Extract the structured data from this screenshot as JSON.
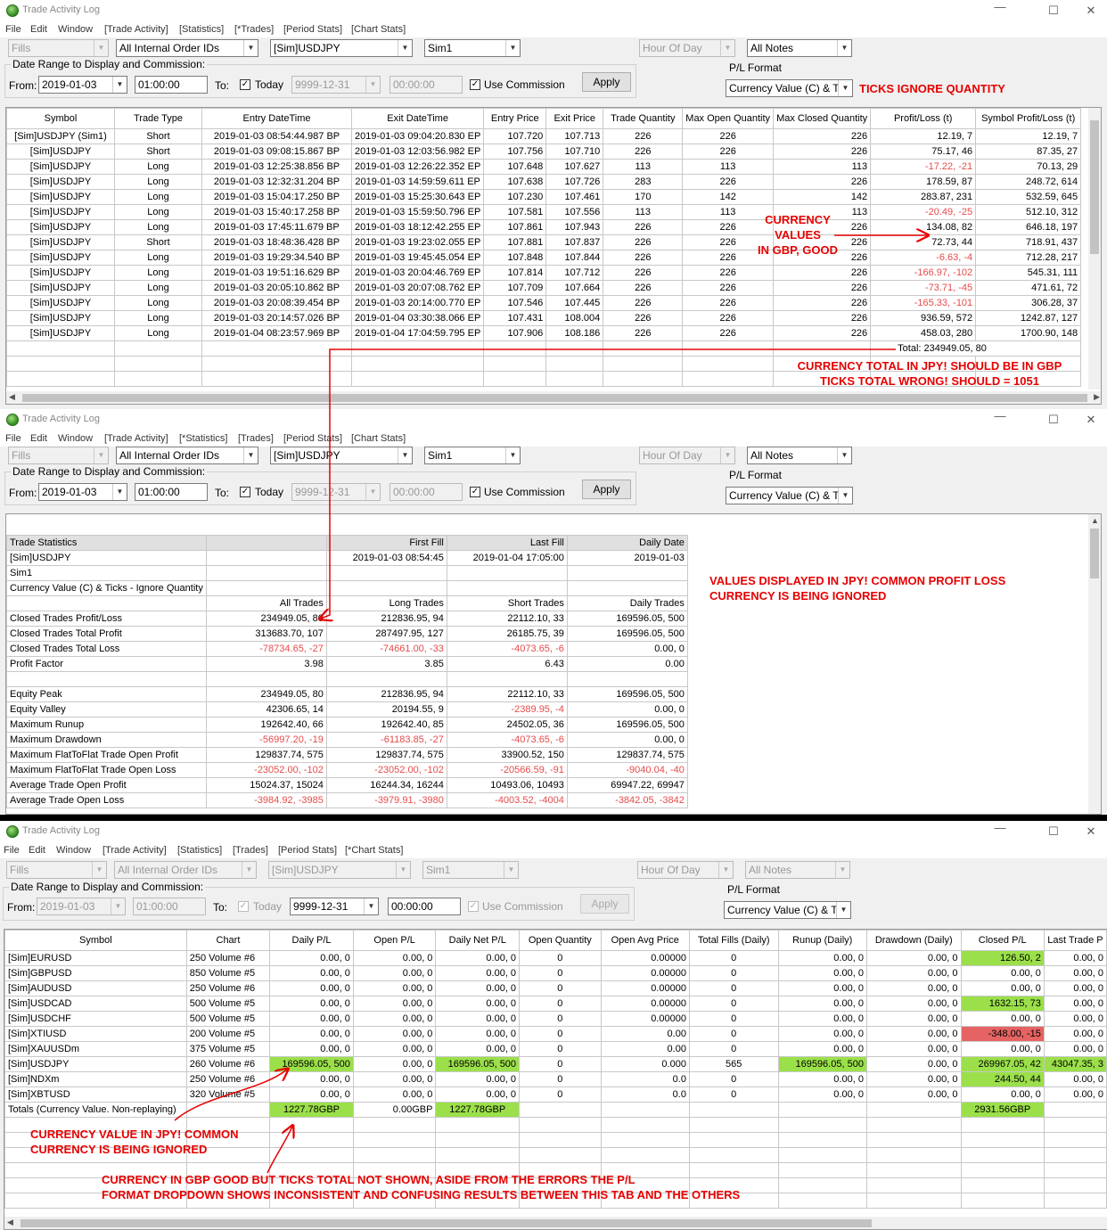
{
  "window_title": "Trade Activity Log",
  "window_controls": {
    "minimize": "—",
    "maximize": "☐",
    "close": "✕"
  },
  "menu": [
    "File",
    "Edit",
    "Window"
  ],
  "w1": {
    "tabs": [
      "[Trade Activity]",
      "[Statistics]",
      "[*Trades]",
      "[Period Stats]",
      "[Chart Stats]"
    ],
    "fills": "Fills",
    "order_ids": "All Internal Order IDs",
    "instrument": "[Sim]USDJPY",
    "account": "Sim1",
    "hour_of_day": "Hour Of Day",
    "notes": "All Notes",
    "date_range_label": "Date Range to Display and Commission:",
    "from_label": "From:",
    "from_date": "2019-01-03",
    "from_time": "01:00:00",
    "to_label": "To:",
    "today_label": "Today",
    "to_date": "9999-12-31",
    "to_time": "00:00:00",
    "use_commission": "Use Commission",
    "apply": "Apply",
    "pl_format_label": "P/L Format",
    "pl_format": "Currency Value (C) & T",
    "columns": [
      "Symbol",
      "Trade Type",
      "Entry DateTime",
      "Exit DateTime",
      "Entry Price",
      "Exit Price",
      "Trade Quantity",
      "Max Open Quantity",
      "Max Closed Quantity",
      "Profit/Loss (t)",
      "Symbol Profit/Loss (t)"
    ],
    "rows": [
      [
        "[Sim]USDJPY (Sim1)",
        "Short",
        "2019-01-03  08:54:44.987 BP",
        "2019-01-03  09:04:20.830 EP",
        "107.720",
        "107.713",
        "226",
        "226",
        "226",
        "12.19, 7",
        "12.19, 7"
      ],
      [
        "[Sim]USDJPY",
        "Short",
        "2019-01-03  09:08:15.867 BP",
        "2019-01-03  12:03:56.982 EP",
        "107.756",
        "107.710",
        "226",
        "226",
        "226",
        "75.17, 46",
        "87.35, 27"
      ],
      [
        "[Sim]USDJPY",
        "Long",
        "2019-01-03  12:25:38.856 BP",
        "2019-01-03  12:26:22.352 EP",
        "107.648",
        "107.627",
        "113",
        "113",
        "113",
        "-17.22, -21",
        "70.13, 29"
      ],
      [
        "[Sim]USDJPY",
        "Long",
        "2019-01-03  12:32:31.204 BP",
        "2019-01-03  14:59:59.611 EP",
        "107.638",
        "107.726",
        "283",
        "226",
        "226",
        "178.59, 87",
        "248.72, 614"
      ],
      [
        "[Sim]USDJPY",
        "Long",
        "2019-01-03  15:04:17.250 BP",
        "2019-01-03  15:25:30.643 EP",
        "107.230",
        "107.461",
        "170",
        "142",
        "142",
        "283.87, 231",
        "532.59, 645"
      ],
      [
        "[Sim]USDJPY",
        "Long",
        "2019-01-03  15:40:17.258 BP",
        "2019-01-03  15:59:50.796 EP",
        "107.581",
        "107.556",
        "113",
        "113",
        "113",
        "-20.49, -25",
        "512.10, 312"
      ],
      [
        "[Sim]USDJPY",
        "Long",
        "2019-01-03  17:45:11.679 BP",
        "2019-01-03  18:12:42.255 EP",
        "107.861",
        "107.943",
        "226",
        "226",
        "226",
        "134.08, 82",
        "646.18, 197"
      ],
      [
        "[Sim]USDJPY",
        "Short",
        "2019-01-03  18:48:36.428 BP",
        "2019-01-03  19:23:02.055 EP",
        "107.881",
        "107.837",
        "226",
        "226",
        "226",
        "72.73, 44",
        "718.91, 437"
      ],
      [
        "[Sim]USDJPY",
        "Long",
        "2019-01-03  19:29:34.540 BP",
        "2019-01-03  19:45:45.054 EP",
        "107.848",
        "107.844",
        "226",
        "226",
        "226",
        "-6.63, -4",
        "712.28, 217"
      ],
      [
        "[Sim]USDJPY",
        "Long",
        "2019-01-03  19:51:16.629 BP",
        "2019-01-03  20:04:46.769 EP",
        "107.814",
        "107.712",
        "226",
        "226",
        "226",
        "-166.97, -102",
        "545.31, 111"
      ],
      [
        "[Sim]USDJPY",
        "Long",
        "2019-01-03  20:05:10.862 BP",
        "2019-01-03  20:07:08.762 EP",
        "107.709",
        "107.664",
        "226",
        "226",
        "226",
        "-73.71, -45",
        "471.61, 72"
      ],
      [
        "[Sim]USDJPY",
        "Long",
        "2019-01-03  20:08:39.454 BP",
        "2019-01-03  20:14:00.770 EP",
        "107.546",
        "107.445",
        "226",
        "226",
        "226",
        "-165.33, -101",
        "306.28, 37"
      ],
      [
        "[Sim]USDJPY",
        "Long",
        "2019-01-03  20:14:57.026 BP",
        "2019-01-04  03:30:38.066 EP",
        "107.431",
        "108.004",
        "226",
        "226",
        "226",
        "936.59, 572",
        "1242.87, 127"
      ],
      [
        "[Sim]USDJPY",
        "Long",
        "2019-01-04  08:23:57.969 BP",
        "2019-01-04  17:04:59.795 EP",
        "107.906",
        "108.186",
        "226",
        "226",
        "226",
        "458.03, 280",
        "1700.90, 148"
      ]
    ],
    "total": "Total: 234949.05, 80",
    "note_ticks": "TICKS IGNORE QUANTITY",
    "note_currency": "CURRENCY\nVALUES\nIN GBP, GOOD",
    "note_total1": "CURRENCY TOTAL IN JPY! SHOULD BE IN GBP",
    "note_total2": "TICKS TOTAL WRONG! SHOULD = 1051"
  },
  "w2": {
    "tabs": [
      "[Trade Activity]",
      "[*Statistics]",
      "[Trades]",
      "[Period Stats]",
      "[Chart Stats]"
    ],
    "rows": [
      [
        "Trade Statistics",
        "",
        "First Fill",
        "Last Fill",
        "Daily Date"
      ],
      [
        "[Sim]USDJPY",
        "",
        "2019-01-03  08:54:45",
        "2019-01-04  17:05:00",
        "2019-01-03"
      ],
      [
        "Sim1",
        "",
        "",
        "",
        ""
      ],
      [
        "Currency Value (C) & Ticks - Ignore Quantity",
        "",
        "",
        "",
        ""
      ],
      [
        "",
        "All Trades",
        "Long Trades",
        "Short Trades",
        "Daily Trades"
      ],
      [
        "Closed Trades Profit/Loss",
        "234949.05, 80",
        "212836.95, 94",
        "22112.10, 33",
        "169596.05, 500"
      ],
      [
        "Closed Trades Total Profit",
        "313683.70, 107",
        "287497.95, 127",
        "26185.75, 39",
        "169596.05, 500"
      ],
      [
        "Closed Trades Total Loss",
        "-78734.65, -27",
        "-74661.00, -33",
        "-4073.65, -6",
        "0.00, 0"
      ],
      [
        "Profit Factor",
        "3.98",
        "3.85",
        "6.43",
        "0.00"
      ],
      [
        "",
        "",
        "",
        "",
        ""
      ],
      [
        "Equity Peak",
        "234949.05, 80",
        "212836.95, 94",
        "22112.10, 33",
        "169596.05, 500"
      ],
      [
        "Equity Valley",
        "42306.65, 14",
        "20194.55, 9",
        "-2389.95, -4",
        "0.00, 0"
      ],
      [
        "Maximum Runup",
        "192642.40, 66",
        "192642.40, 85",
        "24502.05, 36",
        "169596.05, 500"
      ],
      [
        "Maximum Drawdown",
        "-56997.20, -19",
        "-61183.85, -27",
        "-4073.65, -6",
        "0.00, 0"
      ],
      [
        "Maximum FlatToFlat Trade Open Profit",
        "129837.74, 575",
        "129837.74, 575",
        "33900.52, 150",
        "129837.74, 575"
      ],
      [
        "Maximum FlatToFlat Trade Open Loss",
        "-23052.00, -102",
        "-23052.00, -102",
        "-20566.59, -91",
        "-9040.04, -40"
      ],
      [
        "Average Trade Open Profit",
        "15024.37, 15024",
        "16244.34, 16244",
        "10493.06, 10493",
        "69947.22, 69947"
      ],
      [
        "Average Trade Open Loss",
        "-3984.92, -3985",
        "-3979.91, -3980",
        "-4003.52, -4004",
        "-3842.05, -3842"
      ]
    ],
    "note": "VALUES DISPLAYED IN JPY! COMMON PROFIT LOSS\nCURRENCY IS BEING IGNORED"
  },
  "w3": {
    "tabs": [
      "[Trade Activity]",
      "[Statistics]",
      "[Trades]",
      "[Period Stats]",
      "[*Chart Stats]"
    ],
    "columns": [
      "Symbol",
      "Chart",
      "Daily P/L",
      "Open P/L",
      "Daily Net P/L",
      "Open Quantity",
      "Open Avg Price",
      "Total Fills (Daily)",
      "Runup (Daily)",
      "Drawdown (Daily)",
      "Closed P/L",
      "Last Trade P"
    ],
    "rows": [
      [
        "[Sim]EURUSD",
        "250 Volume  #6",
        "0.00, 0",
        "0.00, 0",
        "0.00, 0",
        "0",
        "0.00000",
        "0",
        "0.00, 0",
        "0.00, 0",
        "126.50, 2",
        "0.00, 0"
      ],
      [
        "[Sim]GBPUSD",
        "850 Volume  #5",
        "0.00, 0",
        "0.00, 0",
        "0.00, 0",
        "0",
        "0.00000",
        "0",
        "0.00, 0",
        "0.00, 0",
        "0.00, 0",
        "0.00, 0"
      ],
      [
        "[Sim]AUDUSD",
        "250 Volume  #6",
        "0.00, 0",
        "0.00, 0",
        "0.00, 0",
        "0",
        "0.00000",
        "0",
        "0.00, 0",
        "0.00, 0",
        "0.00, 0",
        "0.00, 0"
      ],
      [
        "[Sim]USDCAD",
        "500 Volume  #5",
        "0.00, 0",
        "0.00, 0",
        "0.00, 0",
        "0",
        "0.00000",
        "0",
        "0.00, 0",
        "0.00, 0",
        "1632.15, 73",
        "0.00, 0"
      ],
      [
        "[Sim]USDCHF",
        "500 Volume  #5",
        "0.00, 0",
        "0.00, 0",
        "0.00, 0",
        "0",
        "0.00000",
        "0",
        "0.00, 0",
        "0.00, 0",
        "0.00, 0",
        "0.00, 0"
      ],
      [
        "[Sim]XTIUSD",
        "200 Volume  #5",
        "0.00, 0",
        "0.00, 0",
        "0.00, 0",
        "0",
        "0.00",
        "0",
        "0.00, 0",
        "0.00, 0",
        "-348.00, -15",
        "0.00, 0"
      ],
      [
        "[Sim]XAUUSDm",
        "375 Volume  #5",
        "0.00, 0",
        "0.00, 0",
        "0.00, 0",
        "0",
        "0.00",
        "0",
        "0.00, 0",
        "0.00, 0",
        "0.00, 0",
        "0.00, 0"
      ],
      [
        "[Sim]USDJPY",
        "260 Volume  #6",
        "169596.05, 500",
        "0.00, 0",
        "169596.05, 500",
        "0",
        "0.000",
        "565",
        "169596.05, 500",
        "0.00, 0",
        "269967.05, 42",
        "43047.35, 3"
      ],
      [
        "[Sim]NDXm",
        "250 Volume  #6",
        "0.00, 0",
        "0.00, 0",
        "0.00, 0",
        "0",
        "0.0",
        "0",
        "0.00, 0",
        "0.00, 0",
        "244.50, 44",
        "0.00, 0"
      ],
      [
        "[Sim]XBTUSD",
        "320 Volume  #5",
        "0.00, 0",
        "0.00, 0",
        "0.00, 0",
        "0",
        "0.0",
        "0",
        "0.00, 0",
        "0.00, 0",
        "0.00, 0",
        "0.00, 0"
      ],
      [
        "Totals (Currency Value. Non-replaying)",
        "",
        "1227.78GBP",
        "0.00GBP",
        "1227.78GBP",
        "",
        "",
        "",
        "",
        "",
        "2931.56GBP",
        ""
      ]
    ],
    "note1": "CURRENCY VALUE IN JPY! COMMON\nCURRENCY IS BEING IGNORED",
    "note2": "CURRENCY IN GBP GOOD BUT TICKS TOTAL NOT SHOWN, ASIDE FROM THE ERRORS THE P/L\nFORMAT DROPDOWN SHOWS INCONSISTENT AND CONFUSING RESULTS BETWEEN THIS TAB AND THE OTHERS"
  },
  "colors": {
    "annotation": "#e60000",
    "negative": "#e64b4b",
    "highlight_green": "#9be04a",
    "highlight_red": "#e66363"
  }
}
